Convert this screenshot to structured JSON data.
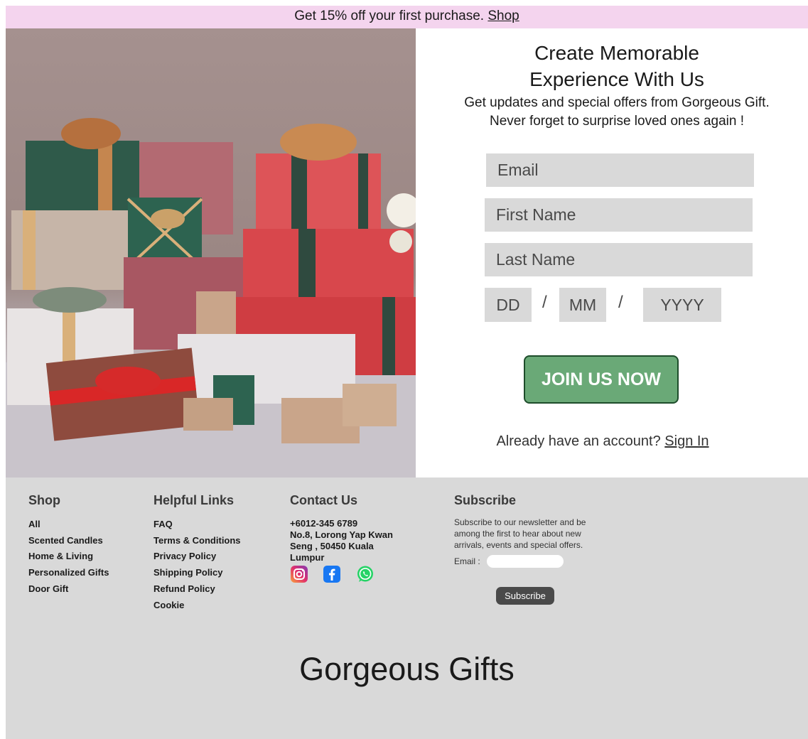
{
  "promo": {
    "text": "Get 15% off your first purchase.",
    "link": "Shop"
  },
  "signup": {
    "title_line1": "Create Memorable",
    "title_line2": "Experience With Us",
    "subtitle_line1": "Get updates and special offers from Gorgeous Gift.",
    "subtitle_line2": "Never forget to surprise loved ones again !",
    "email_placeholder": "Email",
    "first_name_placeholder": "First Name",
    "last_name_placeholder": "Last Name",
    "dob": {
      "day_placeholder": "DD",
      "month_placeholder": "MM",
      "year_placeholder": "YYYY",
      "separator": "/"
    },
    "join_label": "JOIN US NOW",
    "signin_prompt": "Already have an account?",
    "signin_link": "Sign In"
  },
  "footer": {
    "shop": {
      "title": "Shop",
      "items": [
        "All",
        "Scented Candles",
        "Home & Living",
        "Personalized Gifts",
        "Door Gift"
      ]
    },
    "helpful": {
      "title": "Helpful Links",
      "items": [
        "FAQ",
        "Terms & Conditions",
        "Privacy Policy",
        "Shipping Policy",
        "Refund Policy",
        "Cookie"
      ]
    },
    "contact": {
      "title": "Contact Us",
      "phone": "+6012-345 6789",
      "address": "No.8, Lorong Yap Kwan Seng , 50450 Kuala Lumpur",
      "social_icons": [
        "instagram-icon",
        "facebook-icon",
        "whatsapp-icon"
      ]
    },
    "subscribe": {
      "title": "Subscribe",
      "text": "Subscribe to our newsletter and be among the first to hear about new arrivals, events and special offers.",
      "email_label": "Email :",
      "button": "Subscribe"
    },
    "brand": "Gorgeous Gifts"
  },
  "colors": {
    "promo_bg": "#f4d4ee",
    "join_bg": "#6aa977",
    "join_border": "#1e4d2b",
    "footer_bg": "#d9d9d9",
    "field_bg": "#d9d9d9"
  }
}
